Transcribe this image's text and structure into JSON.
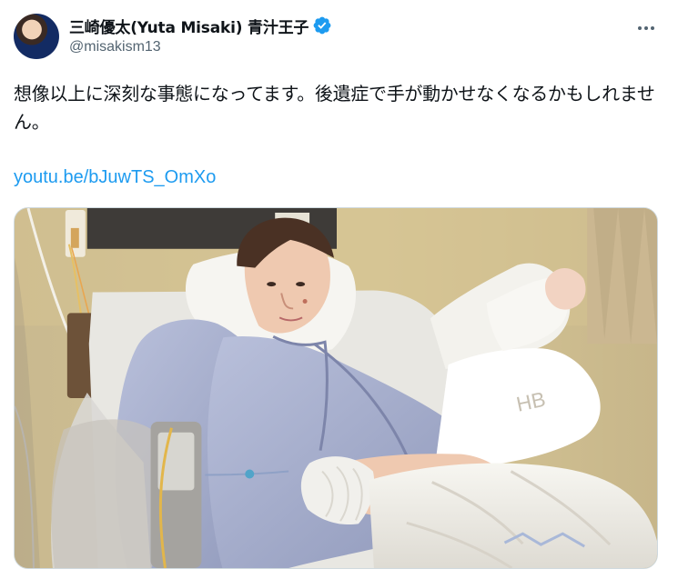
{
  "post": {
    "display_name": "三崎優太(Yuta Misaki) 青汁王子",
    "handle": "@misakism13",
    "text": "想像以上に深刻な事態になってます。後遺症で手が動かせなくなるかもしれません。",
    "link": "youtu.be/bJuwTS_OmXo"
  },
  "icons": {
    "verified": "verified-badge-icon",
    "more": "more-options-icon"
  },
  "colors": {
    "text": "#0f1419",
    "secondary": "#536471",
    "link": "#1d9bf0",
    "verified": "#1d9bf0",
    "border": "#cfd9de"
  }
}
